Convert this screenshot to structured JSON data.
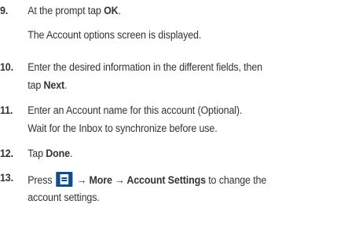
{
  "steps": [
    {
      "number": "9.",
      "lines": [
        [
          "At the prompt tap ",
          "OK",
          "."
        ],
        [
          "The Account options screen is displayed."
        ]
      ]
    },
    {
      "number": "10.",
      "lines": [
        [
          "Enter the desired information in the different fields, then"
        ],
        [
          "tap ",
          "Next",
          "."
        ]
      ]
    },
    {
      "number": "11.",
      "lines": [
        [
          "Enter an Account name for this account (Optional)."
        ],
        [
          "Wait for the Inbox to synchronize before use."
        ]
      ]
    },
    {
      "number": "12.",
      "lines": [
        [
          "Tap ",
          "Done",
          "."
        ]
      ]
    },
    {
      "number": "13.",
      "lines": [
        [
          "Press ",
          " → ",
          "More → Account Settings",
          " to change the"
        ],
        [
          "account settings."
        ]
      ],
      "icon": "menu-key-icon"
    }
  ]
}
